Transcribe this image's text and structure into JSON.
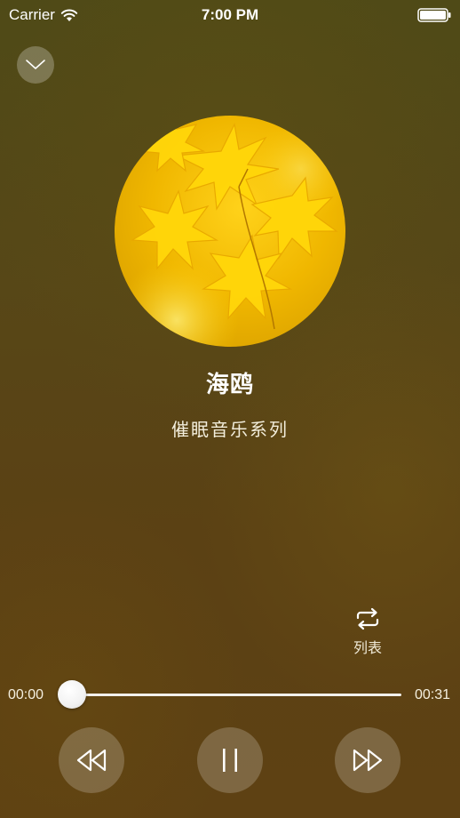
{
  "status_bar": {
    "carrier": "Carrier",
    "time": "7:00 PM",
    "icons": [
      "wifi-icon",
      "battery-icon"
    ]
  },
  "player": {
    "collapse_icon": "chevron-down-icon",
    "song_title": "海鸥",
    "album": "催眠音乐系列",
    "artwork": "yellow-maple-leaves",
    "loop_mode_label": "列表",
    "loop_icon": "repeat-icon",
    "current_time": "00:00",
    "total_time": "00:31",
    "progress": 0.0,
    "controls": {
      "previous_icon": "rewind-icon",
      "play_pause_icon": "pause-icon",
      "next_icon": "fast-forward-icon"
    }
  },
  "colors": {
    "background": "#574717",
    "text": "#ffffff",
    "artwork_yellow": "#f2c200"
  }
}
